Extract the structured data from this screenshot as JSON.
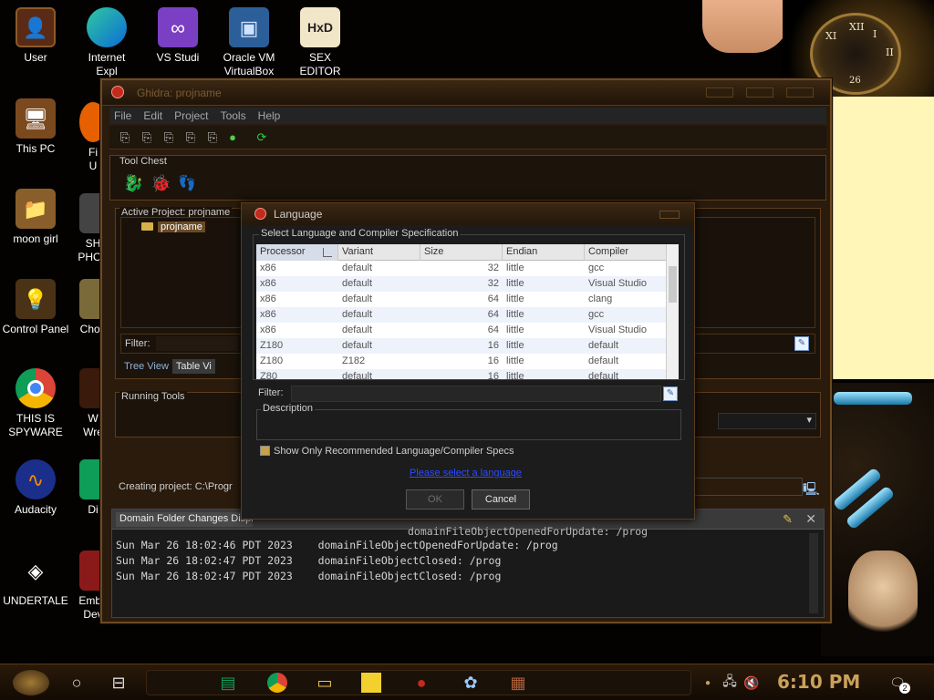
{
  "desktop": {
    "icons_left": [
      {
        "label": "User",
        "icon": "user-icon"
      },
      {
        "label": "This PC",
        "icon": "computer-icon"
      },
      {
        "label": "moon girl",
        "icon": "folder-icon"
      },
      {
        "label": "Control Panel",
        "icon": "control-panel-icon"
      },
      {
        "label": "THIS IS\nSPYWARE",
        "icon": "chrome-icon"
      },
      {
        "label": "Audacity",
        "icon": "audacity-icon"
      },
      {
        "label": "UNDERTALE",
        "icon": "unity-icon"
      }
    ],
    "icons_top": [
      {
        "label": "Internet\nExpl",
        "icon": "edge-icon"
      },
      {
        "label": "VS Studi",
        "icon": "visual-studio-icon"
      },
      {
        "label": "Oracle VM\nVirtualBox",
        "icon": "virtualbox-icon"
      },
      {
        "label": "SEX\nEDITOR",
        "icon": "hxd-icon"
      }
    ],
    "icons_col2": [
      {
        "label": "Fi\nU"
      },
      {
        "label": "SH\nPHOT"
      },
      {
        "label": "Chon"
      },
      {
        "label": "W\nWre"
      },
      {
        "label": "Di"
      },
      {
        "label": "Emba\nDev"
      }
    ],
    "clock_numbers": [
      "XII",
      "I",
      "II",
      "XI",
      "26"
    ]
  },
  "ghidra": {
    "title": "Ghidra: projname",
    "menu": [
      "File",
      "Edit",
      "Project",
      "Tools",
      "Help"
    ],
    "tool_chest_label": "Tool Chest",
    "active_project_label": "Active Project: projname",
    "tree_item": "projname",
    "filter_label": "Filter:",
    "tabs": [
      "Tree View",
      "Table Vi"
    ],
    "running_tools_label": "Running Tools",
    "status": "Creating project: C:\\Progr",
    "log_title": "Domain Folder Changes Displ",
    "log_lines": [
      {
        "date": "",
        "msg": "domainFileObjectOpenedForUpdate: /prog"
      },
      {
        "date": "Sun Mar 26 18:02:46 PDT 2023",
        "msg": "domainFileObjectOpenedForUpdate: /prog"
      },
      {
        "date": "Sun Mar 26 18:02:47 PDT 2023",
        "msg": "domainFileObjectClosed: /prog"
      },
      {
        "date": "Sun Mar 26 18:02:47 PDT 2023",
        "msg": "domainFileObjectClosed: /prog"
      }
    ]
  },
  "dialog": {
    "title": "Language",
    "group_label": "Select Language and Compiler Specification",
    "columns": [
      "Processor",
      "Variant",
      "Size",
      "Endian",
      "Compiler"
    ],
    "rows": [
      [
        "x86",
        "default",
        "32",
        "little",
        "gcc"
      ],
      [
        "x86",
        "default",
        "32",
        "little",
        "Visual Studio"
      ],
      [
        "x86",
        "default",
        "64",
        "little",
        "clang"
      ],
      [
        "x86",
        "default",
        "64",
        "little",
        "gcc"
      ],
      [
        "x86",
        "default",
        "64",
        "little",
        "Visual Studio"
      ],
      [
        "Z180",
        "default",
        "16",
        "little",
        "default"
      ],
      [
        "Z180",
        "Z182",
        "16",
        "little",
        "default"
      ],
      [
        "Z80",
        "default",
        "16",
        "little",
        "default"
      ]
    ],
    "filter_label": "Filter:",
    "description_label": "Description",
    "checkbox_label": "Show Only Recommended Language/Compiler Specs",
    "checkbox_checked": true,
    "link_text": "Please select a language",
    "ok_label": "OK",
    "cancel_label": "Cancel"
  },
  "taskbar": {
    "time": "6:10 PM",
    "notifications": "2",
    "pinned": [
      "sheets-icon",
      "chrome-icon",
      "file-explorer-icon",
      "sticky-notes-icon",
      "ghidra-icon",
      "paint-icon",
      "winrar-icon"
    ]
  },
  "colors": {
    "window_border": "#6e4a22",
    "link": "#2c4cff",
    "row_alt": "#eef2fb",
    "clock_text": "#c9a15a"
  }
}
